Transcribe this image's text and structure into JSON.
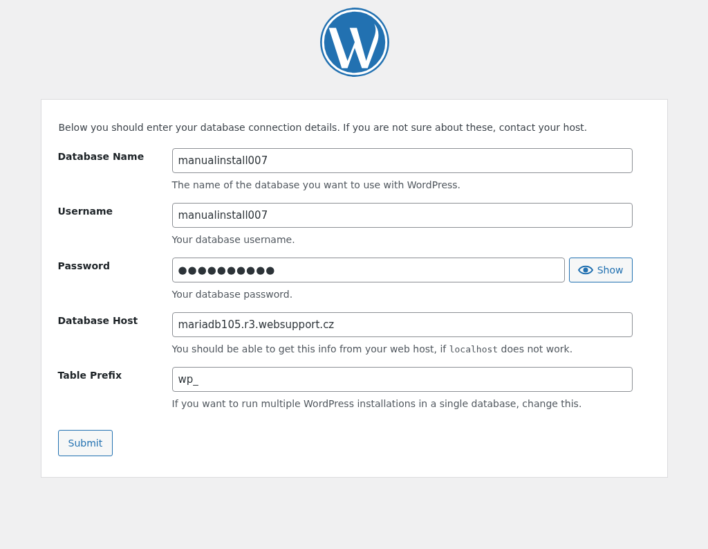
{
  "intro": "Below you should enter your database connection details. If you are not sure about these, contact your host.",
  "fields": [
    {
      "kind": "text",
      "label": "Database Name",
      "value": "manualinstall007",
      "help": [
        {
          "kind": "text",
          "text": "The name of the database you want to use with WordPress."
        }
      ]
    },
    {
      "kind": "text",
      "label": "Username",
      "value": "manualinstall007",
      "help": [
        {
          "kind": "text",
          "text": "Your database username."
        }
      ]
    },
    {
      "kind": "password",
      "label": "Password",
      "value": "●●●●●●●●●●",
      "toggle": "Show",
      "help": [
        {
          "kind": "text",
          "text": "Your database password."
        }
      ]
    },
    {
      "kind": "text",
      "label": "Database Host",
      "value": "mariadb105.r3.websupport.cz",
      "help": [
        {
          "kind": "text",
          "text": "You should be able to get this info from your web host, if "
        },
        {
          "kind": "code",
          "text": "localhost"
        },
        {
          "kind": "text",
          "text": " does not work."
        }
      ]
    },
    {
      "kind": "text",
      "label": "Table Prefix",
      "value": "wp_",
      "help": [
        {
          "kind": "text",
          "text": "If you want to run multiple WordPress installations in a single database, change this."
        }
      ]
    }
  ],
  "submit": "Submit"
}
